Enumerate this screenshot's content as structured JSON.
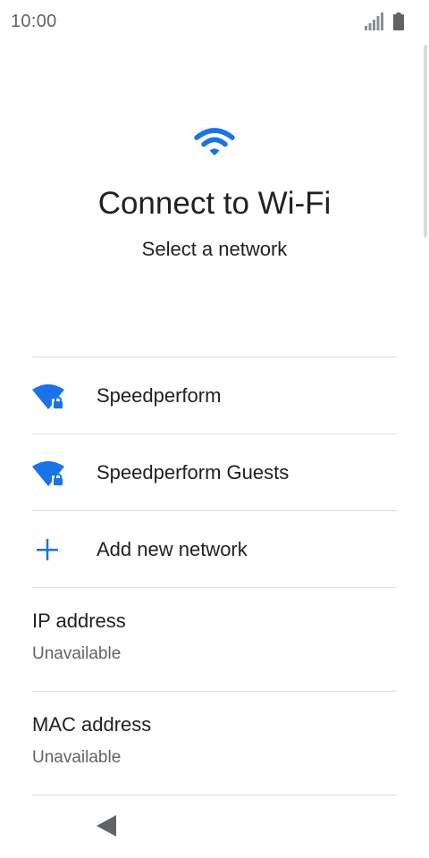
{
  "status_bar": {
    "time": "10:00",
    "signal_icon": "cellular-signal-icon",
    "battery_icon": "battery-full-icon"
  },
  "header": {
    "icon": "wifi-icon",
    "title": "Connect to Wi-Fi",
    "subtitle": "Select a network"
  },
  "networks": [
    {
      "name": "Speedperform",
      "icon": "wifi-locked-icon"
    },
    {
      "name": "Speedperform Guests",
      "icon": "wifi-locked-icon"
    }
  ],
  "add_network": {
    "label": "Add new network",
    "icon": "plus-icon"
  },
  "info": [
    {
      "title": "IP address",
      "value": "Unavailable"
    },
    {
      "title": "MAC address",
      "value": "Unavailable"
    }
  ],
  "nav_bar": {
    "back_icon": "back-icon"
  },
  "colors": {
    "accent": "#1a73e8",
    "text_primary": "#202124",
    "text_secondary": "#5f6368",
    "divider": "#dadce0"
  }
}
